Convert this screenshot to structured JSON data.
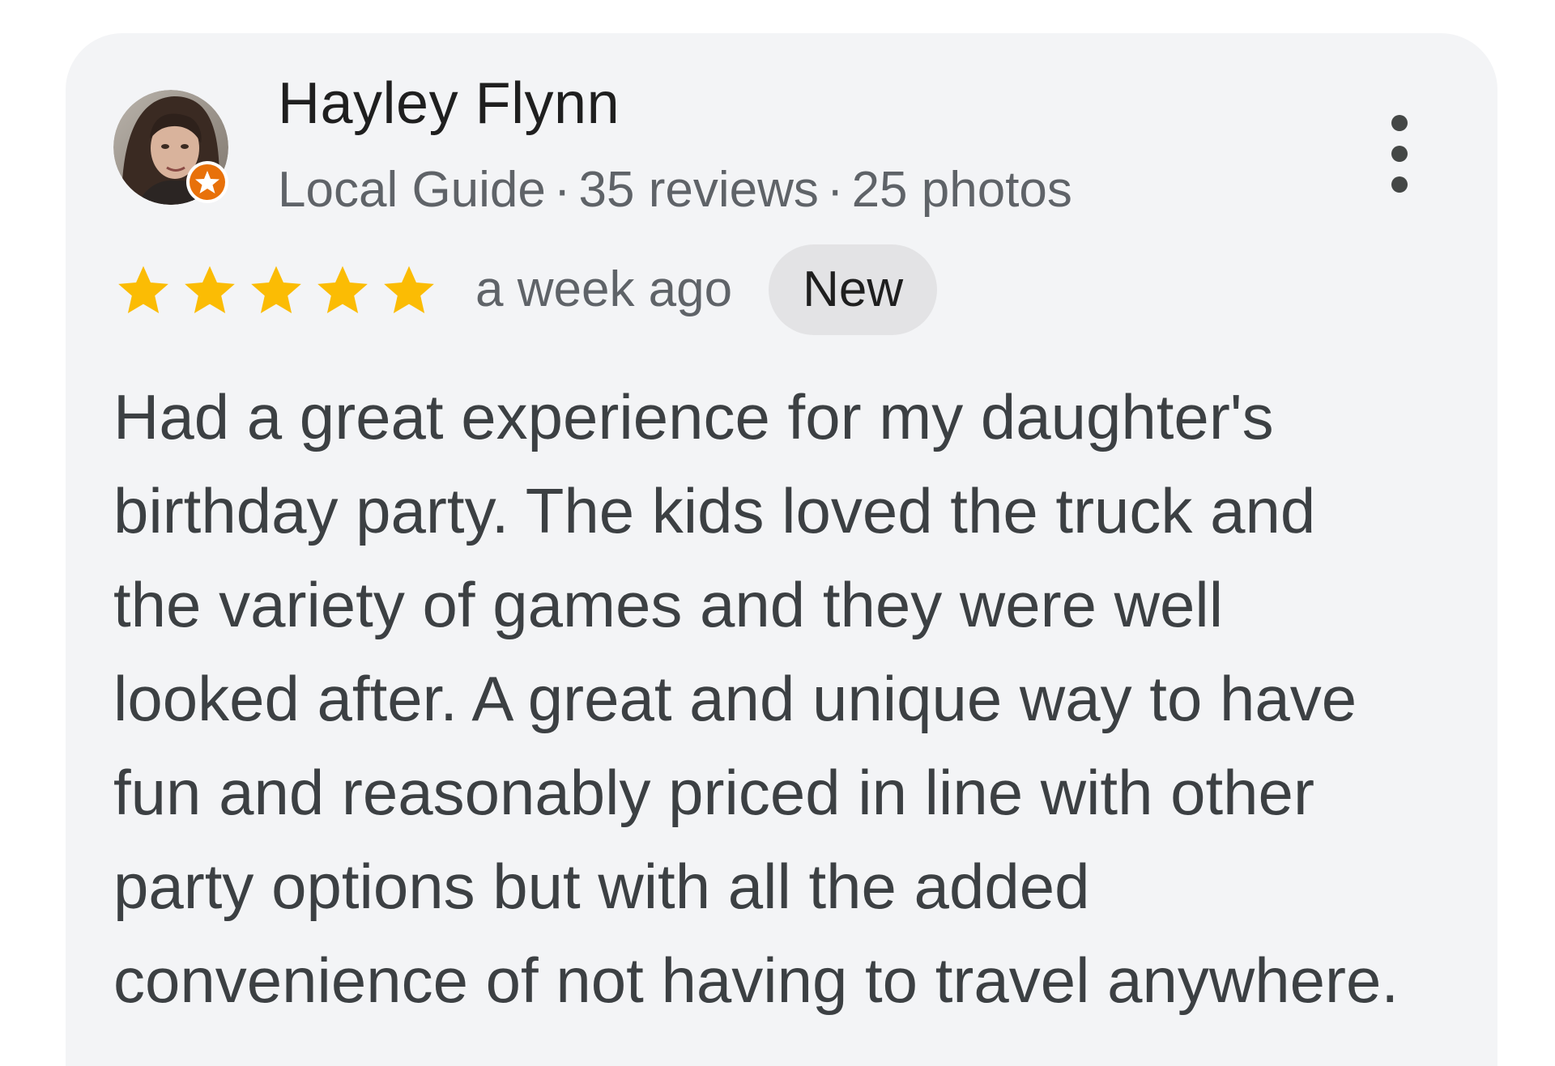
{
  "review": {
    "reviewer": {
      "name": "Hayley Flynn",
      "badge": "Local Guide",
      "reviews_count": "35 reviews",
      "photos_count": "25 photos",
      "separator": "·",
      "avatar_icon": "person-photo",
      "badge_icon": "local-guide-star-icon"
    },
    "rating": {
      "stars": 5,
      "max_stars": 5,
      "star_color": "#fbbc04"
    },
    "timestamp": "a week ago",
    "new_badge": "New",
    "text_lines": [
      "Had a great experience for my daughter's",
      "birthday party. The kids loved the truck and",
      "the variety of games and they were well",
      "looked after. A great and unique way to have",
      "fun and reasonably priced in line with other",
      "party options but with all the added",
      "convenience of not having to travel anywhere."
    ],
    "more_icon": "more-vert-icon"
  },
  "colors": {
    "card_background": "#f3f4f6",
    "badge_orange": "#e8710a",
    "chip_background": "#e3e3e5"
  }
}
